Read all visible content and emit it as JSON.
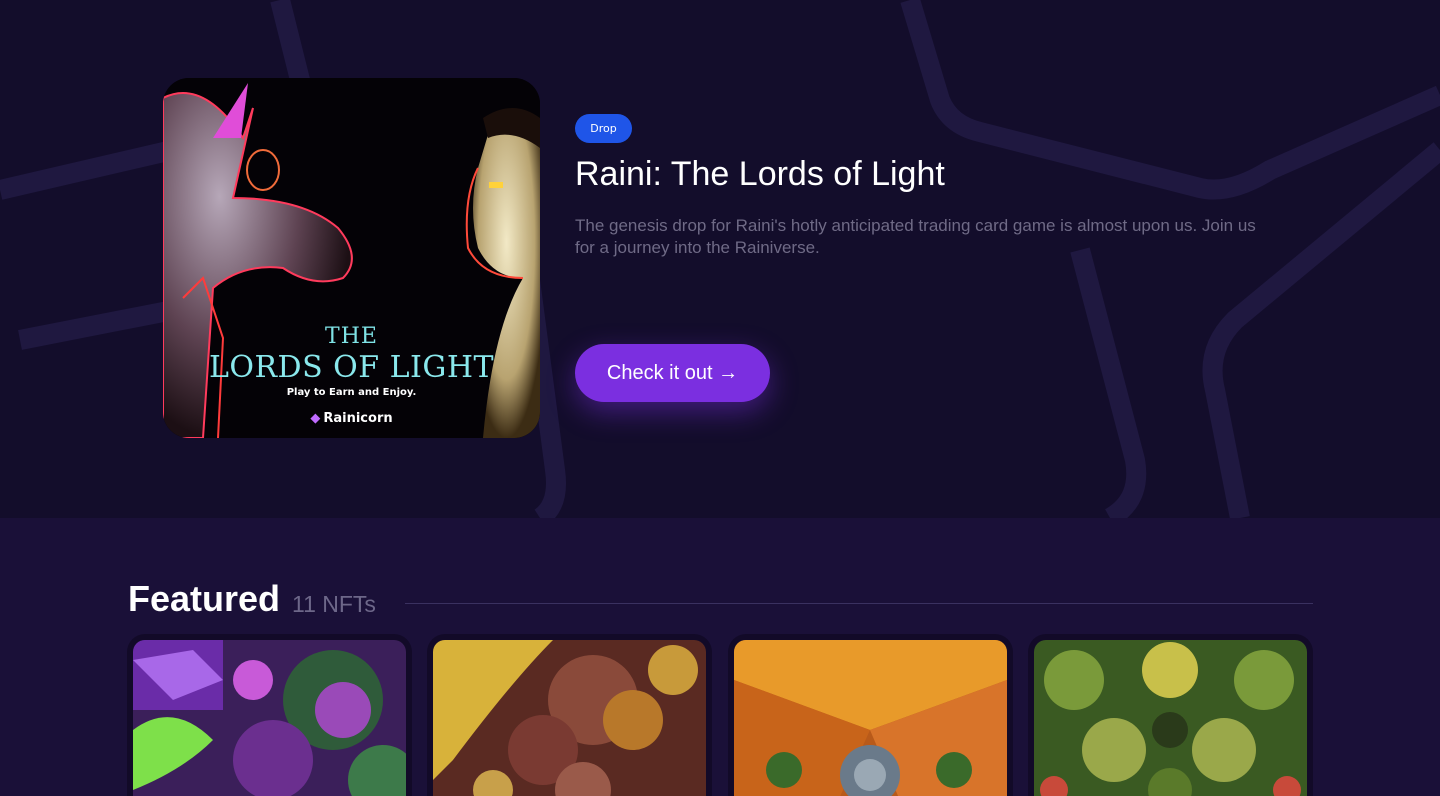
{
  "hero": {
    "badge": "Drop",
    "title": "Raini: The Lords of Light",
    "description": "The genesis drop for Raini's hotly anticipated trading card game is almost upon us. Join us for a journey into the Rainiverse.",
    "cta_label": "Check it out →",
    "artwork": {
      "the": "THE",
      "lords": "LORDS OF LIGHT",
      "tagline": "Play to Earn and Enjoy.",
      "brand": "Rainicorn"
    }
  },
  "featured": {
    "title": "Featured",
    "count": "11 NFTs",
    "cards": [
      {
        "theme": "purple-green-fractal"
      },
      {
        "theme": "gold-red-fractal"
      },
      {
        "theme": "orange-gold-fractal"
      },
      {
        "theme": "green-red-fractal"
      }
    ]
  },
  "colors": {
    "hero_background": "#130d2b",
    "page_background": "#1a1038",
    "badge": "#1f55e8",
    "cta": "#7b2fe0",
    "muted_text": "#6f6a86"
  }
}
